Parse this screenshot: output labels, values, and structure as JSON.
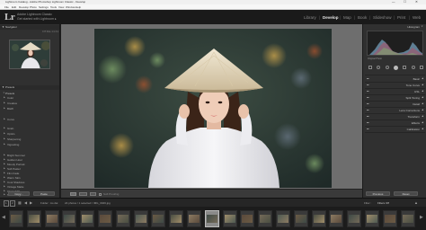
{
  "titlebar": {
    "title": "Lightroom Catalog - Adobe Photoshop Lightroom Classic - Develop",
    "minimize": "—",
    "maximize": "☐",
    "close": "✕"
  },
  "menu": [
    "File",
    "Edit",
    "Develop",
    "Photo",
    "Settings",
    "Tools",
    "View",
    "Window",
    "Help"
  ],
  "identity": {
    "logo": "Lr",
    "line1": "Adobe Lightroom Classic",
    "line2": "Get started with Lightroom ▸"
  },
  "modules": [
    "Library",
    "Develop",
    "Map",
    "Book",
    "Slideshow",
    "Print",
    "Web"
  ],
  "active_module": "Develop",
  "left_panel": {
    "navigator_label": "Navigator",
    "navigator_zoom": "FIT  FILL  1:1  3:1",
    "presets_label": "Presets",
    "presets_section": "Presets",
    "preset_items": [
      "Color",
      "Creative",
      "B&W",
      "Curve",
      "Grain",
      "Optics",
      "Sharpening",
      "Vignetting"
    ],
    "user_items": [
      "Bright Summer",
      "Golden Hour",
      "Moody Portrait",
      "Soft Pastel",
      "Film Fade",
      "Warm Skin",
      "Cool Shadows",
      "Vintage Matte",
      "Clean Edit",
      "Natural Light"
    ],
    "copy_button": "Copy...",
    "paste_button": "Paste"
  },
  "right_panel": {
    "histogram_label": "Histogram",
    "original_photo_label": "Original Photo",
    "sections": [
      "Basic",
      "Tone Curve",
      "HSL",
      "Split Toning",
      "Detail",
      "Lens Corrections",
      "Transform",
      "Effects",
      "Calibration"
    ],
    "previous_button": "Previous",
    "reset_button": "Reset"
  },
  "toolbar": {
    "softproof_label": "Soft Proofing"
  },
  "filmbar": {
    "page1": "1",
    "page2": "2",
    "folder_info": "Folder : Ao dai",
    "count_info": "24 photos / 1 selected / IMG_0046.jpg",
    "filter_label": "Filter :",
    "filter_value": "Filters Off"
  },
  "filmstrip": {
    "thumb_count": 23,
    "selected_index": 11
  }
}
